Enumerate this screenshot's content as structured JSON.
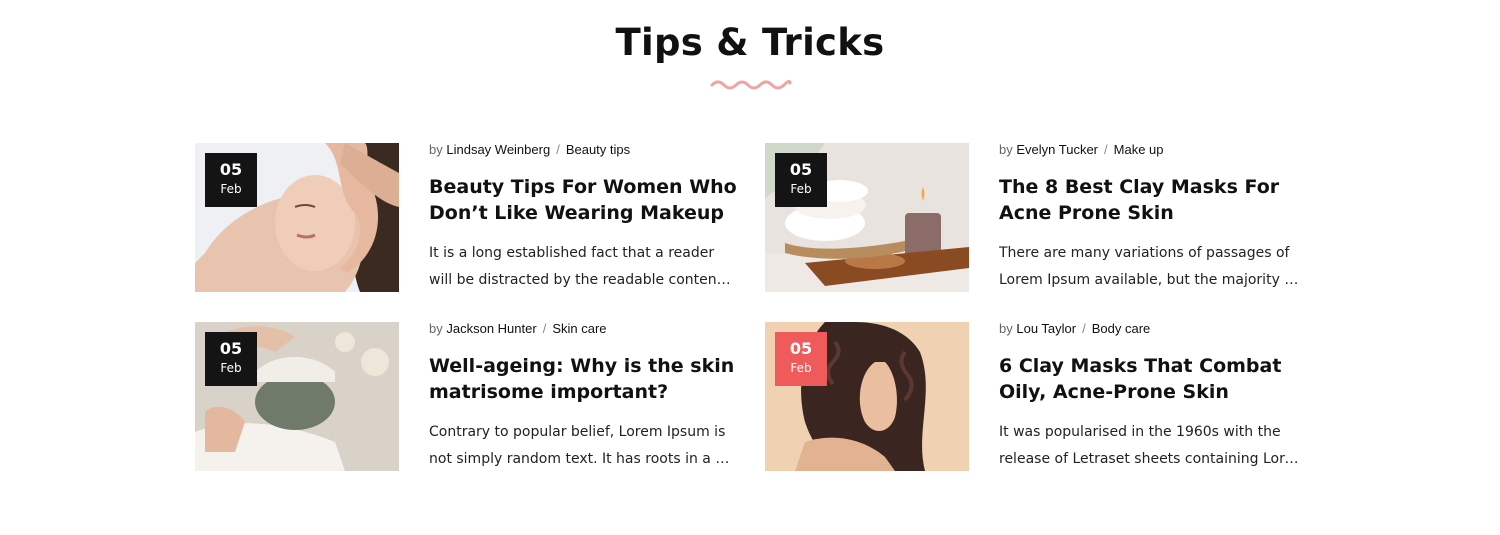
{
  "section": {
    "title": "Tips & Tricks",
    "accent_color": "#ef5a5a",
    "wave_color": "#f0a3a3"
  },
  "posts": [
    {
      "day": "05",
      "month": "Feb",
      "highlight": false,
      "by": "by",
      "author": "Lindsay Weinberg",
      "category": "Beauty tips",
      "title_lines": [
        "Beauty Tips For Women Who",
        "Don’t Like Wearing Makeup"
      ],
      "excerpt_lines": [
        "It is a long established fact that a reader",
        "will be distracted by the readable content of a page"
      ],
      "image": "face-massage-photo"
    },
    {
      "day": "05",
      "month": "Feb",
      "highlight": false,
      "by": "by",
      "author": "Evelyn Tucker",
      "category": "Make up",
      "title_lines": [
        "The 8 Best Clay Masks For",
        "Acne Prone Skin"
      ],
      "excerpt_lines": [
        "There are many variations of passages of",
        "Lorem Ipsum available, but the majority have suffered"
      ],
      "image": "spa-towels-candle-photo"
    },
    {
      "day": "05",
      "month": "Feb",
      "highlight": false,
      "by": "by",
      "author": "Jackson Hunter",
      "category": "Skin care",
      "title_lines": [
        "Well-ageing: Why is the skin",
        "matrisome important?"
      ],
      "excerpt_lines": [
        "Contrary to popular belief, Lorem Ipsum is",
        "not simply random text. It has roots in a piece"
      ],
      "image": "clay-face-mask-photo"
    },
    {
      "day": "05",
      "month": "Feb",
      "highlight": true,
      "by": "by",
      "author": "Lou Taylor",
      "category": "Body care",
      "title_lines": [
        "6 Clay Masks That Combat",
        "Oily, Acne-Prone Skin"
      ],
      "excerpt_lines": [
        "It was popularised in the 1960s with the",
        "release of Letraset sheets containing Lorem Ipsum"
      ],
      "image": "curly-hair-woman-photo"
    }
  ]
}
